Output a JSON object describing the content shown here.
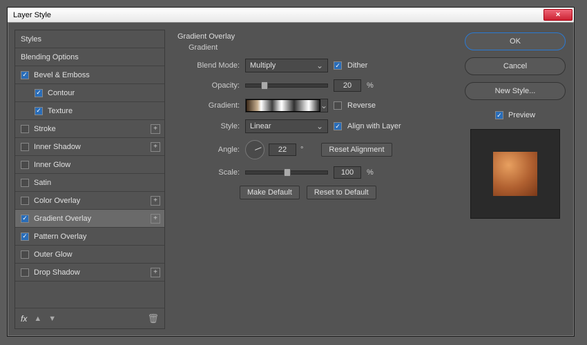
{
  "window": {
    "title": "Layer Style"
  },
  "sidebar": {
    "items": [
      {
        "label": "Styles",
        "hasCheck": false
      },
      {
        "label": "Blending Options",
        "hasCheck": false
      },
      {
        "label": "Bevel & Emboss",
        "hasCheck": true,
        "checked": true
      },
      {
        "label": "Contour",
        "hasCheck": true,
        "checked": true,
        "indent": true
      },
      {
        "label": "Texture",
        "hasCheck": true,
        "checked": true,
        "indent": true
      },
      {
        "label": "Stroke",
        "hasCheck": true,
        "checked": false,
        "add": true
      },
      {
        "label": "Inner Shadow",
        "hasCheck": true,
        "checked": false,
        "add": true
      },
      {
        "label": "Inner Glow",
        "hasCheck": true,
        "checked": false
      },
      {
        "label": "Satin",
        "hasCheck": true,
        "checked": false
      },
      {
        "label": "Color Overlay",
        "hasCheck": true,
        "checked": false,
        "add": true
      },
      {
        "label": "Gradient Overlay",
        "hasCheck": true,
        "checked": true,
        "add": true,
        "selected": true
      },
      {
        "label": "Pattern Overlay",
        "hasCheck": true,
        "checked": true
      },
      {
        "label": "Outer Glow",
        "hasCheck": true,
        "checked": false
      },
      {
        "label": "Drop Shadow",
        "hasCheck": true,
        "checked": false,
        "add": true
      }
    ],
    "fx": "fx"
  },
  "panel": {
    "title": "Gradient Overlay",
    "subtitle": "Gradient",
    "blendMode": {
      "label": "Blend Mode:",
      "value": "Multiply"
    },
    "dither": {
      "label": "Dither",
      "checked": true
    },
    "opacity": {
      "label": "Opacity:",
      "value": "20",
      "unit": "%",
      "pct": 20
    },
    "gradient": {
      "label": "Gradient:"
    },
    "reverse": {
      "label": "Reverse",
      "checked": false
    },
    "style": {
      "label": "Style:",
      "value": "Linear"
    },
    "align": {
      "label": "Align with Layer",
      "checked": true
    },
    "angle": {
      "label": "Angle:",
      "value": "22",
      "unit": "°"
    },
    "resetAlign": "Reset Alignment",
    "scale": {
      "label": "Scale:",
      "value": "100",
      "unit": "%",
      "pct": 50
    },
    "makeDefault": "Make Default",
    "resetDefault": "Reset to Default"
  },
  "right": {
    "ok": "OK",
    "cancel": "Cancel",
    "newStyle": "New Style...",
    "preview": "Preview",
    "previewChecked": true
  }
}
